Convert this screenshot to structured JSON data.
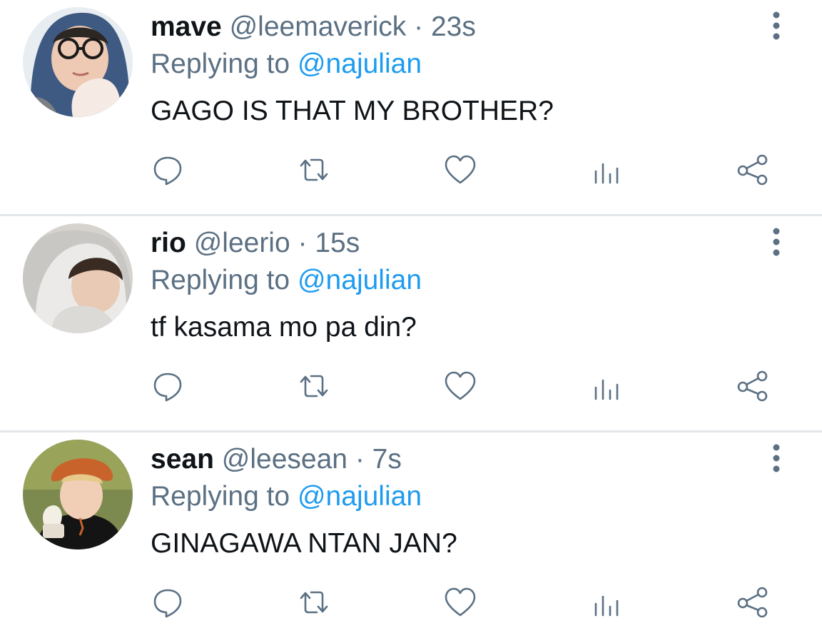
{
  "colors": {
    "text": "#0f1419",
    "secondary": "#5b7083",
    "accent": "#1d9bf0",
    "divider": "#e3e6e8"
  },
  "tweets": [
    {
      "name": "mave",
      "handle": "@leemaverick",
      "separator": "·",
      "time": "23s",
      "replying_prefix": "Replying to",
      "replying_to": "@najulian",
      "text": "GAGO IS THAT MY BROTHER?",
      "avatar_icon": "user-avatar-glasses-hood",
      "actions": [
        "reply-icon",
        "retweet-icon",
        "like-icon",
        "analytics-icon",
        "share-icon"
      ]
    },
    {
      "name": "rio",
      "handle": "@leerio",
      "separator": "·",
      "time": "15s",
      "replying_prefix": "Replying to",
      "replying_to": "@najulian",
      "text": "tf kasama mo pa din?",
      "avatar_icon": "user-avatar-white-hood",
      "actions": [
        "reply-icon",
        "retweet-icon",
        "like-icon",
        "analytics-icon",
        "share-icon"
      ]
    },
    {
      "name": "sean",
      "handle": "@leesean",
      "separator": "·",
      "time": "7s",
      "replying_prefix": "Replying to",
      "replying_to": "@najulian",
      "text": "GINAGAWA NTAN JAN?",
      "avatar_icon": "user-avatar-orange-hat",
      "actions": [
        "reply-icon",
        "retweet-icon",
        "like-icon",
        "analytics-icon",
        "share-icon"
      ]
    }
  ]
}
